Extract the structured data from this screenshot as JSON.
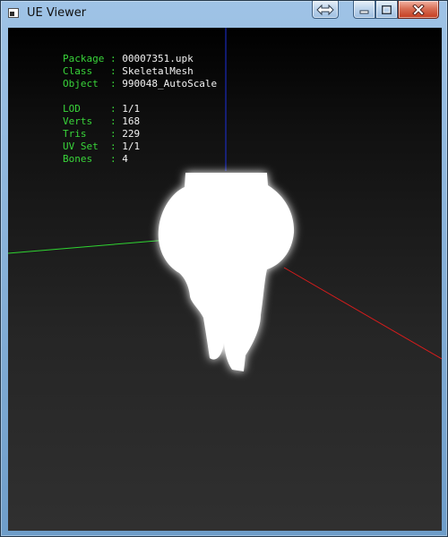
{
  "window": {
    "title": "UE Viewer",
    "title_buttons": {
      "swap": "swap-display",
      "minimize": "minimize",
      "maximize": "maximize",
      "close": "close"
    }
  },
  "viewer": {
    "info": [
      {
        "label": "Package",
        "separator": " : ",
        "value": "00007351.upk"
      },
      {
        "label": "Class  ",
        "separator": " : ",
        "value": "SkeletalMesh"
      },
      {
        "label": "Object ",
        "separator": " : ",
        "value": "990048_AutoScale"
      },
      {
        "label": "LOD    ",
        "separator": " : ",
        "value": "1/1"
      },
      {
        "label": "Verts  ",
        "separator": " : ",
        "value": "168"
      },
      {
        "label": "Tris   ",
        "separator": " : ",
        "value": "229"
      },
      {
        "label": "UV Set ",
        "separator": " : ",
        "value": "1/1"
      },
      {
        "label": "Bones  ",
        "separator": " : ",
        "value": "4"
      }
    ],
    "axes": {
      "x_color": "#d71c1c",
      "y_color": "#2fd431",
      "z_color": "#1d2fd8"
    },
    "mesh_color": "#ffffff",
    "background": "#202020"
  },
  "icons": {
    "app": "ue-viewer-app-icon",
    "swap": "swap-arrows-icon",
    "minimize": "minimize-icon",
    "maximize": "maximize-icon",
    "close": "close-icon"
  }
}
